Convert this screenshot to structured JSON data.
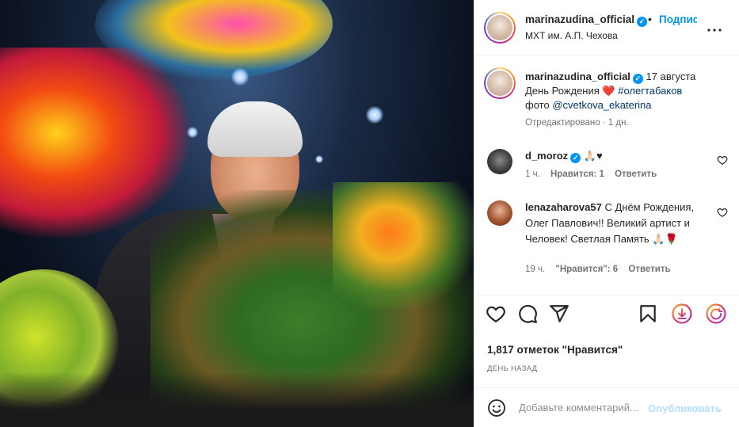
{
  "header": {
    "username": "marinazudina_official",
    "verified_mark": "✓",
    "separator": "•",
    "follow_label": "Подписаться",
    "location": "МХТ им. А.П. Чехова",
    "more_label": "•••"
  },
  "caption": {
    "username": "marinazudina_official",
    "date": "17 августа",
    "line1": "День Рождения",
    "heart": "❤️",
    "hashtag": "#олегтабаков",
    "photo_prefix": "фото",
    "photo_credit": "@cvetkova_ekaterina",
    "edited": "Отредактировано · 1 дн."
  },
  "comments": [
    {
      "username": "d_moroz",
      "text": "🙏🏻♥",
      "time": "1 ч.",
      "likes": "Нравится: 1",
      "reply": "Ответить"
    },
    {
      "username": "lenazaharova57",
      "text": "С Днём Рождения, Олег Павлович!! Великий артист и Человек! Светлая Память 🙏🏻🌹",
      "time": "19 ч.",
      "likes": "\"Нравится\": 6",
      "reply": "Ответить"
    }
  ],
  "actions": {
    "like_icon": "heart-icon",
    "comment_icon": "comment-icon",
    "share_icon": "share-icon",
    "save_icon": "bookmark-icon"
  },
  "likes_text": "1,817 отметок \"Нравится\"",
  "time_ago": "ДЕНЬ НАЗАД",
  "add_comment": {
    "placeholder": "Добавьте комментарий...",
    "publish_label": "Опубликовать"
  },
  "colors": {
    "accent": "#0095f6",
    "heart": "#ed4956",
    "muted": "#737373"
  }
}
